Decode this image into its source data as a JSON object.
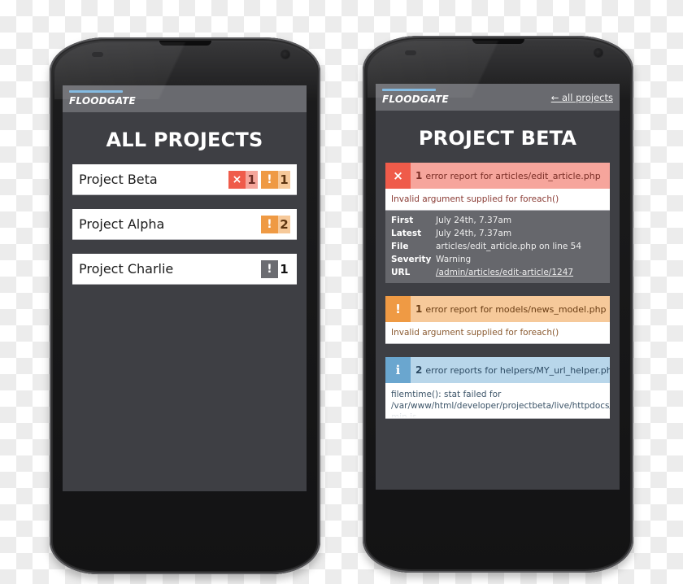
{
  "app": {
    "logo": "FLOODGATE"
  },
  "left_screen": {
    "title": "ALL PROJECTS",
    "projects": [
      {
        "name": "Project Beta",
        "badges": [
          {
            "type": "error",
            "icon": "×",
            "count": "1"
          },
          {
            "type": "warning",
            "icon": "!",
            "count": "1"
          }
        ]
      },
      {
        "name": "Project Alpha",
        "badges": [
          {
            "type": "warning",
            "icon": "!",
            "count": "2"
          }
        ]
      },
      {
        "name": "Project Charlie",
        "badges": [
          {
            "type": "notice",
            "icon": "!",
            "count": "1"
          }
        ]
      }
    ]
  },
  "right_screen": {
    "back_link": "← all projects",
    "title": "PROJECT BETA",
    "cards": [
      {
        "type": "error",
        "icon": "×",
        "count": "1",
        "heading": "error report for articles/edit_article.php",
        "message": "Invalid argument supplied for foreach()",
        "details": [
          {
            "label": "First",
            "value": "July 24th, 7.37am"
          },
          {
            "label": "Latest",
            "value": "July 24th, 7.37am"
          },
          {
            "label": "File",
            "value": "articles/edit_article.php on line 54"
          },
          {
            "label": "Severity",
            "value": "Warning"
          },
          {
            "label": "URL",
            "value": "/admin/articles/edit-article/1247"
          }
        ]
      },
      {
        "type": "warning",
        "icon": "!",
        "count": "1",
        "heading": "error report for models/news_model.php",
        "message": "Invalid argument supplied for foreach()"
      },
      {
        "type": "info",
        "icon": "i",
        "count": "2",
        "heading": "error reports for helpers/MY_url_helper.php",
        "message_lines": [
          "filemtime(): stat failed for",
          "/var/www/html/developer/projectbeta/live/httpdocs/f",
          "min.js"
        ]
      }
    ]
  },
  "colors": {
    "error": "#ef5b4a",
    "error_light": "#f6a59c",
    "warning": "#ef9a44",
    "warning_light": "#f6c99a",
    "info": "#6aa6cf",
    "info_light": "#b8d6ea",
    "notice": "#6b6c71",
    "logo_bar": "#7bb6e0",
    "screen_bg": "#3e3f44",
    "appbar_bg": "#696a6f"
  }
}
